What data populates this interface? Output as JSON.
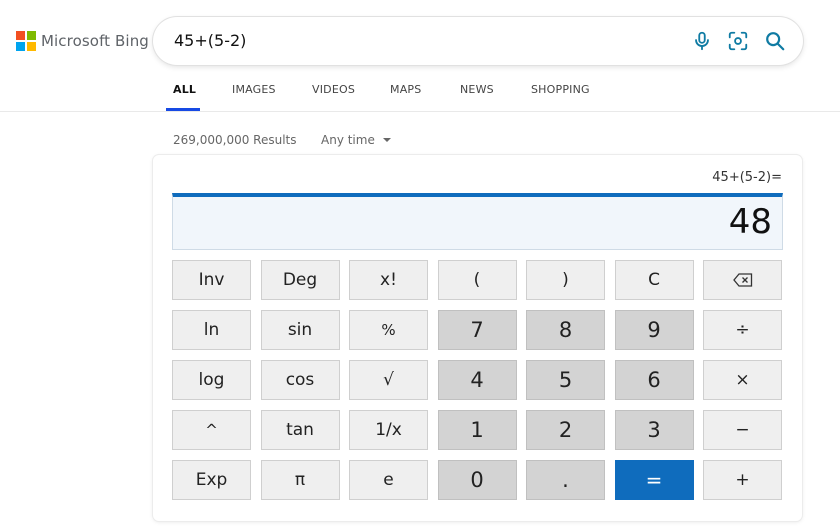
{
  "brand": {
    "logo_text": "Microsoft Bing",
    "logo_colors": [
      "#f25022",
      "#7fba00",
      "#00a4ef",
      "#ffb900"
    ]
  },
  "search": {
    "query": "45+(5-2)",
    "icons": [
      "microphone-icon",
      "visual-search-icon",
      "search-icon"
    ],
    "accent": "#0f7ba3"
  },
  "tabs": [
    {
      "label": "ALL",
      "active": true
    },
    {
      "label": "IMAGES",
      "active": false
    },
    {
      "label": "VIDEOS",
      "active": false
    },
    {
      "label": "MAPS",
      "active": false
    },
    {
      "label": "NEWS",
      "active": false
    },
    {
      "label": "SHOPPING",
      "active": false
    }
  ],
  "results": {
    "count_text": "269,000,000 Results",
    "time_filter": "Any time"
  },
  "calculator": {
    "expression": "45+(5-2)=",
    "result": "48",
    "accent": "#0f6cbd",
    "keys": [
      [
        "Inv",
        "Deg",
        "x!",
        "(",
        ")",
        "C",
        "⌫"
      ],
      [
        "ln",
        "sin",
        "%",
        "7",
        "8",
        "9",
        "÷"
      ],
      [
        "log",
        "cos",
        "√",
        "4",
        "5",
        "6",
        "×"
      ],
      [
        "^",
        "tan",
        "1/x",
        "1",
        "2",
        "3",
        "−"
      ],
      [
        "Exp",
        "π",
        "e",
        "0",
        ".",
        "=",
        "+"
      ]
    ]
  }
}
